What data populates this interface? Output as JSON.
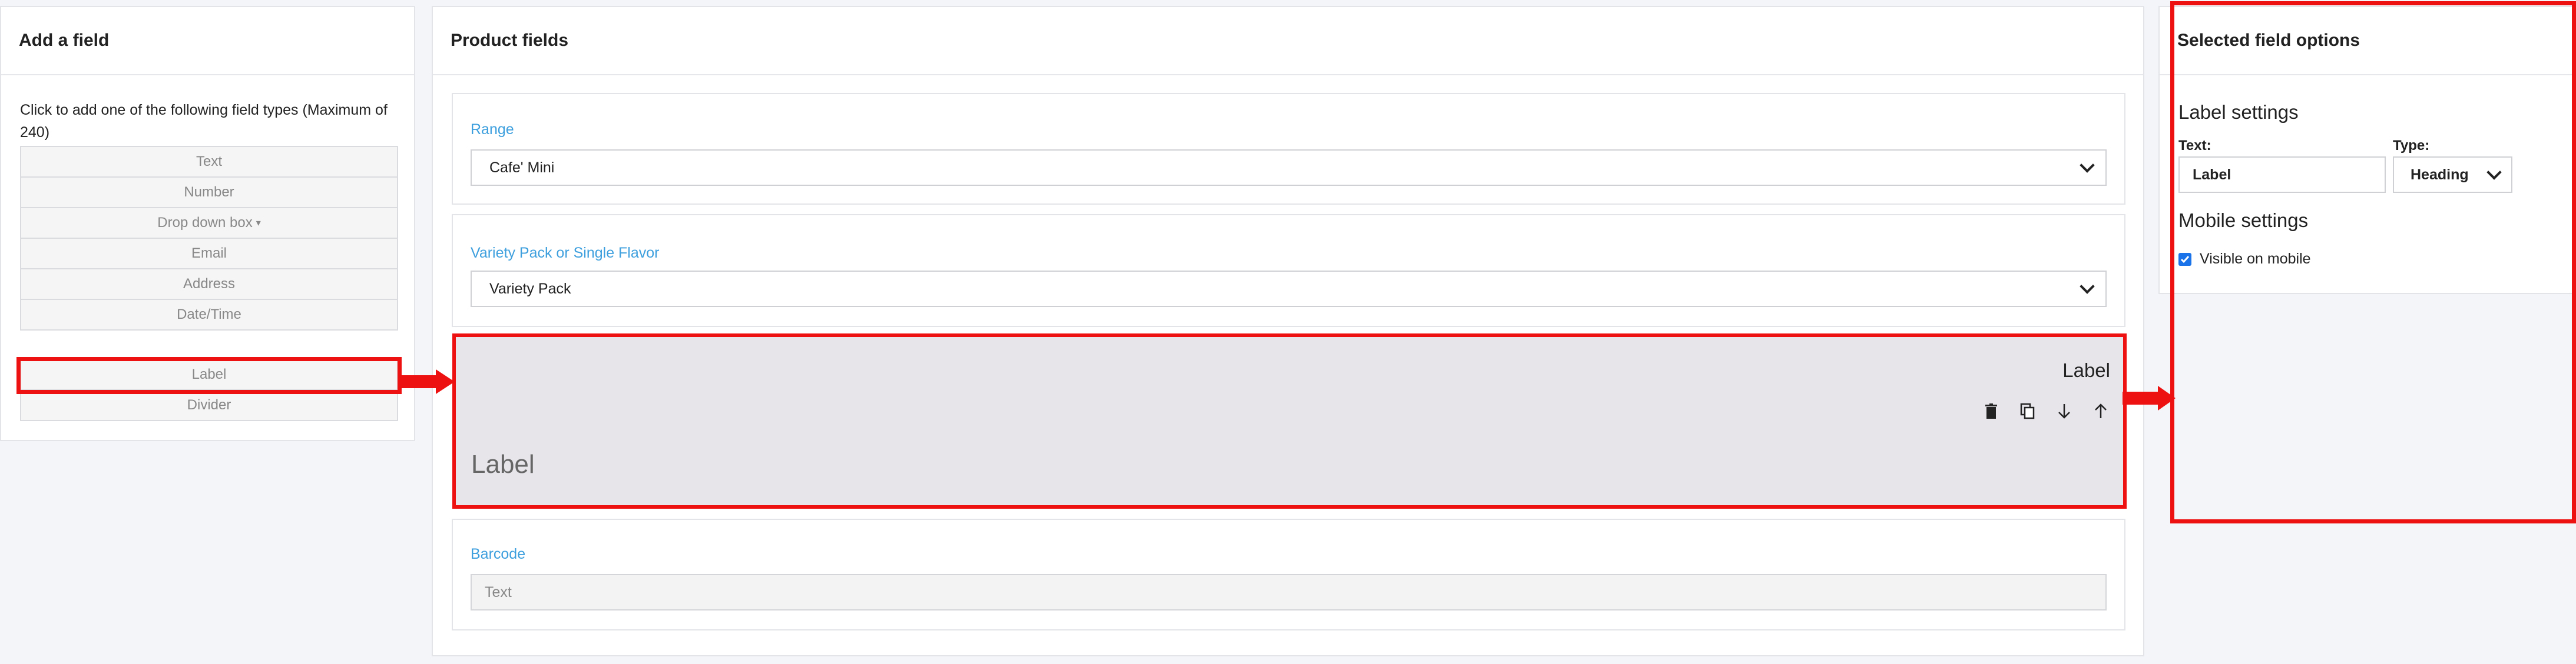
{
  "left_panel": {
    "title": "Add a field",
    "instructions": "Click to add one of the following field types (Maximum of 240)",
    "field_types": [
      {
        "label": "Text"
      },
      {
        "label": "Number"
      },
      {
        "label": "Drop down box"
      },
      {
        "label": "Email"
      },
      {
        "label": "Address"
      },
      {
        "label": "Date/Time"
      }
    ],
    "layout_types": [
      {
        "label": "Label"
      },
      {
        "label": "Divider"
      }
    ]
  },
  "middle_panel": {
    "title": "Product fields",
    "fields": {
      "range": {
        "label": "Range",
        "value": "Cafe' Mini"
      },
      "variety": {
        "label": "Variety Pack or Single Flavor",
        "value": "Variety Pack"
      },
      "label_block": {
        "type_title": "Label",
        "text": "Label"
      },
      "barcode": {
        "label": "Barcode",
        "placeholder": "Text"
      }
    }
  },
  "right_panel": {
    "title": "Selected field options",
    "label_settings": {
      "heading": "Label settings",
      "text_label": "Text:",
      "text_value": "Label",
      "type_label": "Type:",
      "type_value": "Heading"
    },
    "mobile_settings": {
      "heading": "Mobile settings",
      "visible_label": "Visible on mobile",
      "visible_checked": true
    }
  },
  "colors": {
    "accent_blue": "#3d9fdd",
    "highlight_red": "#ee1111",
    "selected_bg": "#e7e4ea"
  },
  "icons": [
    "trash-icon",
    "copy-icon",
    "arrow-down-icon",
    "arrow-up-icon",
    "check-icon",
    "chevron-down-icon",
    "caret-down-icon"
  ]
}
